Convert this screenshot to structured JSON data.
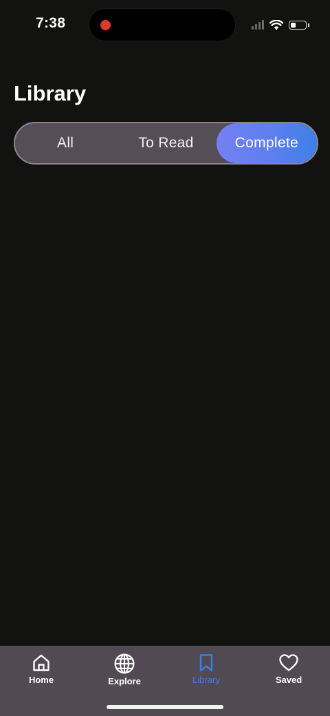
{
  "status_bar": {
    "time": "7:38",
    "battery_level": 0.25
  },
  "header": {
    "title": "Library"
  },
  "filters": {
    "options": [
      {
        "label": "All",
        "selected": false
      },
      {
        "label": "To Read",
        "selected": false
      },
      {
        "label": "Complete",
        "selected": true
      }
    ]
  },
  "tab_bar": {
    "items": [
      {
        "label": "Home",
        "icon": "house-icon",
        "active": false
      },
      {
        "label": "Explore",
        "icon": "globe-icon",
        "active": false
      },
      {
        "label": "Library",
        "icon": "bookmark-icon",
        "active": true
      },
      {
        "label": "Saved",
        "icon": "heart-icon",
        "active": false
      }
    ]
  },
  "colors": {
    "background": "#121210",
    "accent_gradient_start": "#7480f2",
    "accent_gradient_end": "#3f7fe6",
    "active_tab": "#3c7fe3",
    "tab_bar": "#524a53"
  }
}
